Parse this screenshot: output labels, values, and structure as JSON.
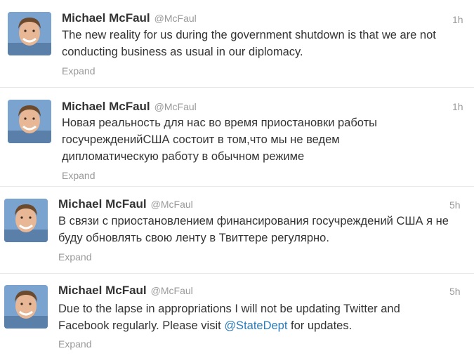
{
  "tweets": [
    {
      "author": "Michael McFaul",
      "handle": "@McFaul",
      "time": "1h",
      "text": "The new reality for us during the government shutdown is that we are not conducting business as usual in our diplomacy.",
      "expand": "Expand"
    },
    {
      "author": "Michael McFaul",
      "handle": "@McFaul",
      "time": "1h",
      "text": "Новая реальность для нас во время приостановки работы госучрежденийСША состоит в том,что мы не ведем дипломатическую работу в обычном режиме",
      "expand": "Expand"
    },
    {
      "author": "Michael McFaul",
      "handle": "@McFaul",
      "time": "5h",
      "text": "В связи с приостановлением финансирования госучреждений США я не буду обновлять свою ленту в Твиттере регулярно.",
      "expand": "Expand"
    },
    {
      "author": "Michael McFaul",
      "handle": "@McFaul",
      "time": "5h",
      "text_before": "Due to the lapse in appropriations I will not be updating Twitter and Facebook regularly. Please visit ",
      "mention": "@StateDept",
      "text_after": " for updates.",
      "expand": "Expand"
    }
  ],
  "colors": {
    "link": "#2b7bb9",
    "muted": "#999999",
    "text": "#333333"
  }
}
